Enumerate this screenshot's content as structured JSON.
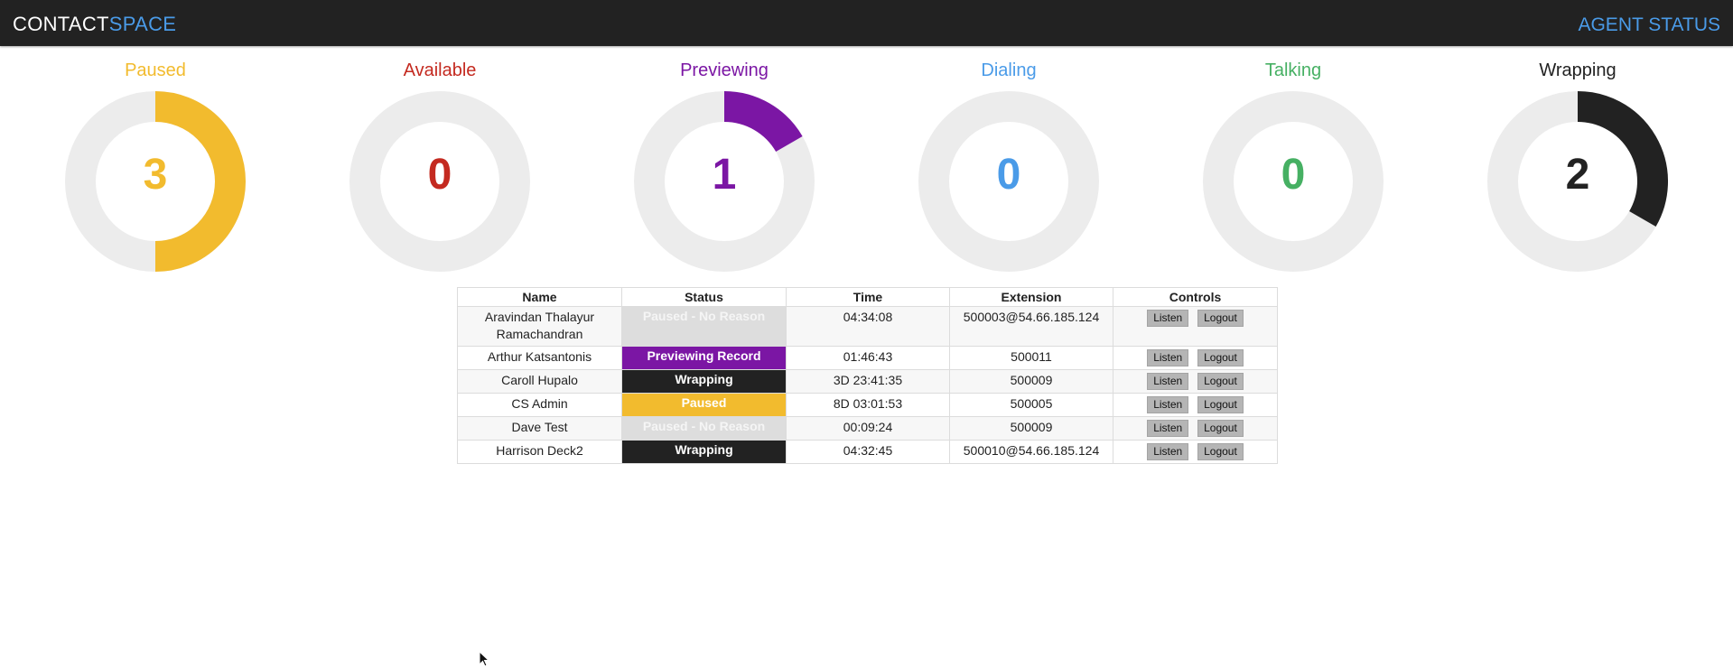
{
  "header": {
    "brand_part1": "CONTACT",
    "brand_part2": "SPACE",
    "page_title": "AGENT STATUS"
  },
  "summary": [
    {
      "label": "Paused",
      "count": 3,
      "color": "#f2bb2e"
    },
    {
      "label": "Available",
      "count": 0,
      "color": "#c42a20"
    },
    {
      "label": "Previewing",
      "count": 1,
      "color": "#7b16a4"
    },
    {
      "label": "Dialing",
      "count": 0,
      "color": "#4a9be8"
    },
    {
      "label": "Talking",
      "count": 0,
      "color": "#46b063"
    },
    {
      "label": "Wrapping",
      "count": 2,
      "color": "#222222"
    }
  ],
  "total_agents": 6,
  "table": {
    "headers": {
      "name": "Name",
      "status": "Status",
      "time": "Time",
      "extension": "Extension",
      "controls": "Controls"
    },
    "listen_label": "Listen",
    "logout_label": "Logout",
    "rows": [
      {
        "name_line1": "Aravindan Thalayur",
        "name_line2": "Ramachandran",
        "status": "Paused - No Reason",
        "time": "04:34:08",
        "extension": "500003@54.66.185.124"
      },
      {
        "name_line1": "Arthur Katsantonis",
        "name_line2": "",
        "status": "Previewing Record",
        "time": "01:46:43",
        "extension": "500011"
      },
      {
        "name_line1": "Caroll Hupalo",
        "name_line2": "",
        "status": "Wrapping",
        "time": "3D 23:41:35",
        "extension": "500009"
      },
      {
        "name_line1": "CS Admin",
        "name_line2": "",
        "status": "Paused",
        "time": "8D 03:01:53",
        "extension": "500005"
      },
      {
        "name_line1": "Dave Test",
        "name_line2": "",
        "status": "Paused - No Reason",
        "time": "00:09:24",
        "extension": "500009"
      },
      {
        "name_line1": "Harrison Deck2",
        "name_line2": "",
        "status": "Wrapping",
        "time": "04:32:45",
        "extension": "500010@54.66.185.124"
      }
    ]
  },
  "colors": {
    "topbar": "#222222",
    "accent": "#4a9be8",
    "donut_track": "#ececec"
  }
}
